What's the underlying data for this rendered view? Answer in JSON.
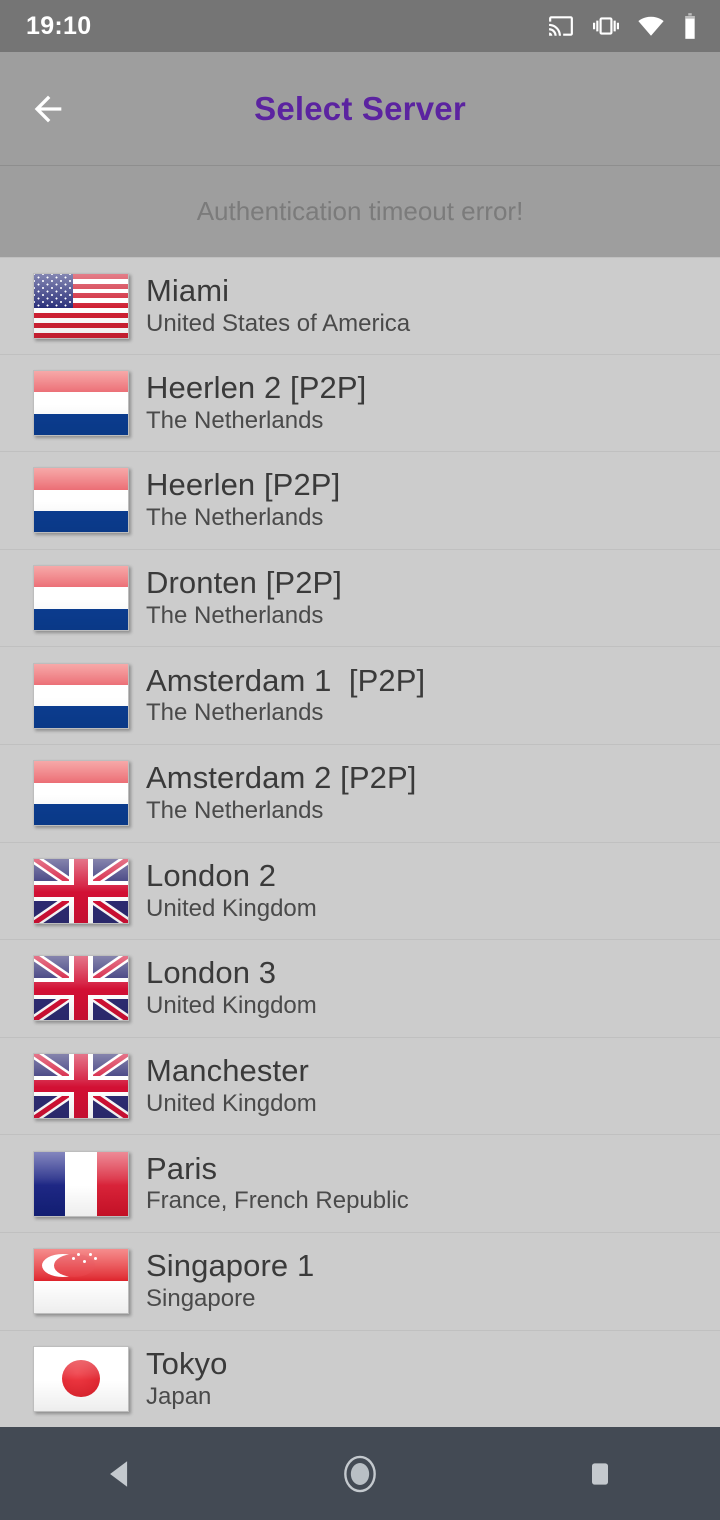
{
  "status_bar": {
    "clock": "19:10",
    "icons": [
      "cast-icon",
      "vibrate-icon",
      "wifi-icon",
      "battery-icon"
    ]
  },
  "app_bar": {
    "back_icon": "back-arrow-icon",
    "title": "Select Server",
    "title_color": "#5b23a0",
    "background_color": "#9e9e9e"
  },
  "error_banner": {
    "message": "Authentication timeout error!"
  },
  "server_list": [
    {
      "city": "Miami",
      "country": "United States of America",
      "flag": "us"
    },
    {
      "city": "Heerlen 2 [P2P]",
      "country": "The Netherlands",
      "flag": "nl"
    },
    {
      "city": "Heerlen [P2P]",
      "country": "The Netherlands",
      "flag": "nl"
    },
    {
      "city": "Dronten [P2P]",
      "country": "The Netherlands",
      "flag": "nl"
    },
    {
      "city": "Amsterdam 1  [P2P]",
      "country": "The Netherlands",
      "flag": "nl"
    },
    {
      "city": "Amsterdam 2 [P2P]",
      "country": "The Netherlands",
      "flag": "nl"
    },
    {
      "city": "London 2",
      "country": "United Kingdom",
      "flag": "uk"
    },
    {
      "city": "London 3",
      "country": "United Kingdom",
      "flag": "uk"
    },
    {
      "city": "Manchester",
      "country": "United Kingdom",
      "flag": "uk"
    },
    {
      "city": "Paris",
      "country": "France, French Republic",
      "flag": "fr"
    },
    {
      "city": "Singapore 1",
      "country": "Singapore",
      "flag": "sg"
    },
    {
      "city": "Tokyo",
      "country": "Japan",
      "flag": "jp"
    }
  ],
  "nav_bar": {
    "back_label": "back-triangle-icon",
    "home_label": "home-circle-icon",
    "recents_label": "recents-square-icon"
  },
  "colors": {
    "status_bar": "#757575",
    "app_bar": "#9e9e9e",
    "list_background": "#cccccc",
    "nav_bar": "#434a54",
    "accent": "#5b23a0"
  }
}
